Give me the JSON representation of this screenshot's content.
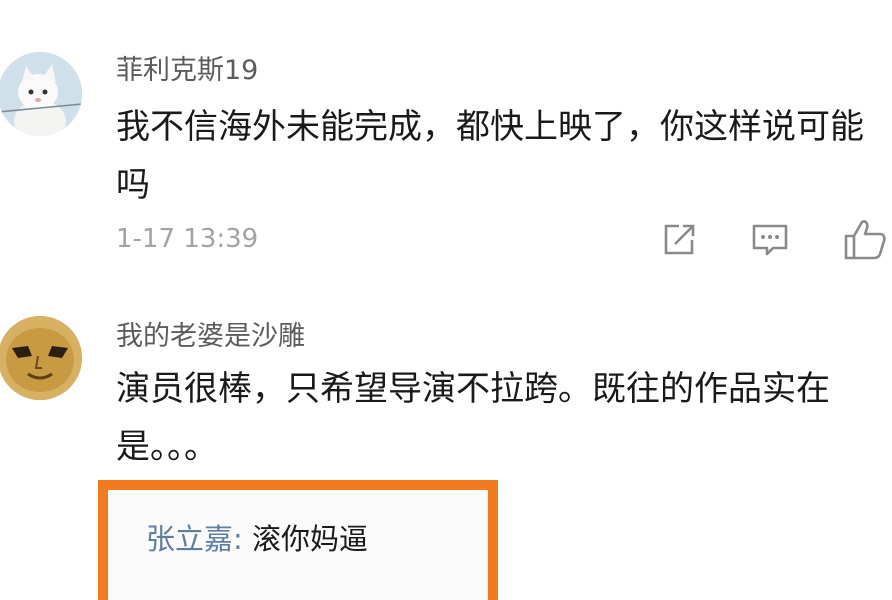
{
  "comments": [
    {
      "username": "菲利克斯19",
      "text": "我不信海外未能完成，都快上映了，你这样说可能吗",
      "time": "1-17 13:39",
      "avatar_icon": "white-cat-avatar"
    },
    {
      "username": "我的老婆是沙雕",
      "text": "演员很棒，只希望导演不拉跨。既往的作品实在是。。。",
      "avatar_icon": "gold-mask-avatar",
      "reply": {
        "author": "张立嘉",
        "separator": ": ",
        "text": "滚你妈逼"
      }
    }
  ],
  "actions": {
    "share_icon": "share-icon",
    "reply_icon": "comment-icon",
    "like_icon": "thumbs-up-icon"
  },
  "colors": {
    "highlight_border": "#f47a20",
    "reply_author": "#5f7fa0",
    "meta_text": "#a3a3a3"
  }
}
